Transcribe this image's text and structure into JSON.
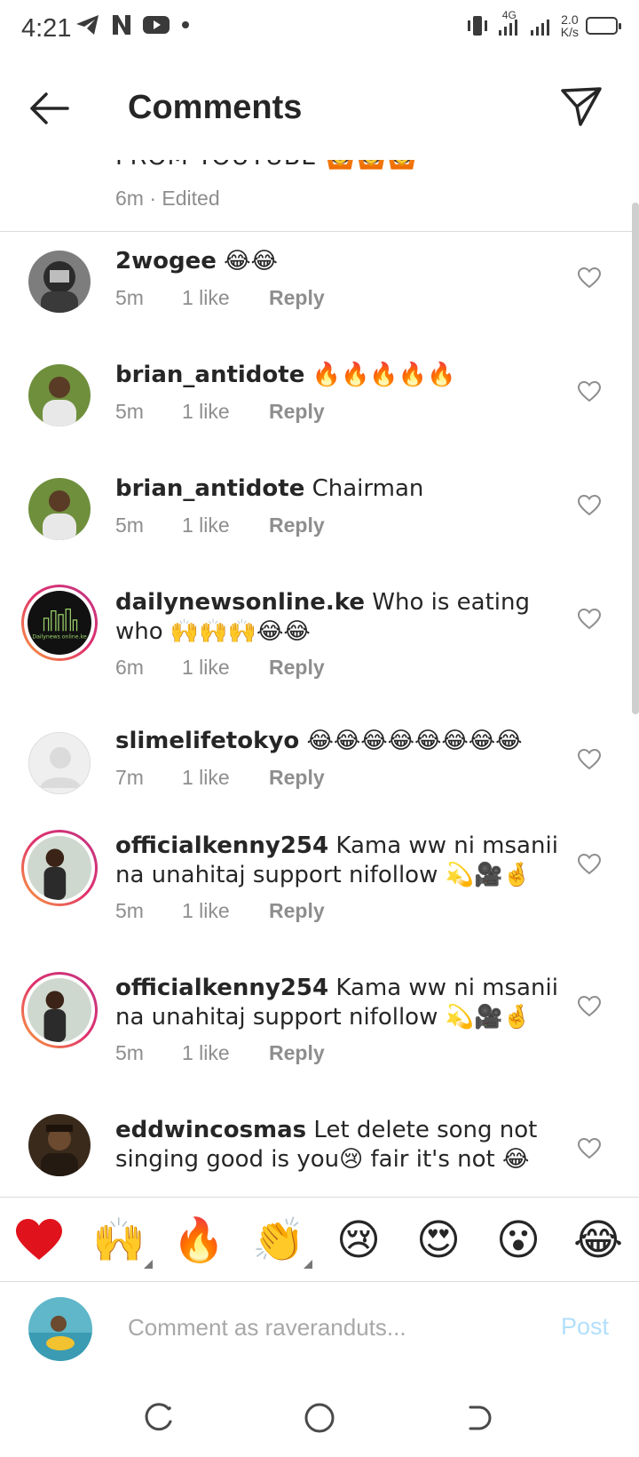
{
  "status_bar": {
    "time": "4:21",
    "network": "4G",
    "speed_value": "2.0",
    "speed_unit": "K/s"
  },
  "header": {
    "title": "Comments",
    "back_icon": "arrow-left-icon",
    "send_icon": "paper-plane-icon"
  },
  "caption": {
    "text": "FROM YOUTUBE 🙆🙆🙆",
    "meta": "6m · Edited"
  },
  "comments": [
    {
      "username": "2wogee",
      "text": " 😂😂",
      "time": "5m",
      "likes": "1 like",
      "reply": "Reply"
    },
    {
      "username": "brian_antidote",
      "text": " 🔥🔥🔥🔥🔥",
      "time": "5m",
      "likes": "1 like",
      "reply": "Reply"
    },
    {
      "username": "brian_antidote",
      "text": " Chairman",
      "time": "5m",
      "likes": "1 like",
      "reply": "Reply"
    },
    {
      "username": "dailynewsonline.ke",
      "text": " Who is eating who 🙌🙌🙌😂😂",
      "time": "6m",
      "likes": "1 like",
      "reply": "Reply"
    },
    {
      "username": "slimelifetokyo",
      "text": " 😂😂😂😂😂😂😂😂",
      "time": "7m",
      "likes": "1 like",
      "reply": "Reply"
    },
    {
      "username": "officialkenny254",
      "text": " Kama ww ni msanii na unahitaj support nifollow 💫🎥🤞",
      "time": "5m",
      "likes": "1 like",
      "reply": "Reply"
    },
    {
      "username": "officialkenny254",
      "text": " Kama ww ni msanii na unahitaj support nifollow 💫🎥🤞",
      "time": "5m",
      "likes": "1 like",
      "reply": "Reply"
    },
    {
      "username": "eddwincosmas",
      "text": " Let delete song not singing good is you😢 fair it's not 😂",
      "time": "",
      "likes": "",
      "reply": ""
    }
  ],
  "reactions": [
    "❤️",
    "🙌",
    "🔥",
    "👏",
    "😢",
    "😍",
    "😮",
    "😂"
  ],
  "composer": {
    "placeholder": "Comment as raveranduts...",
    "post_label": "Post"
  },
  "avatar_logo_text": "Dailynews online.ke",
  "colors": {
    "text": "#262626",
    "meta": "#8e8e8e",
    "post_disabled": "#b2dffc",
    "divider": "#dbdbdb",
    "heart_red": "#e0121b"
  }
}
